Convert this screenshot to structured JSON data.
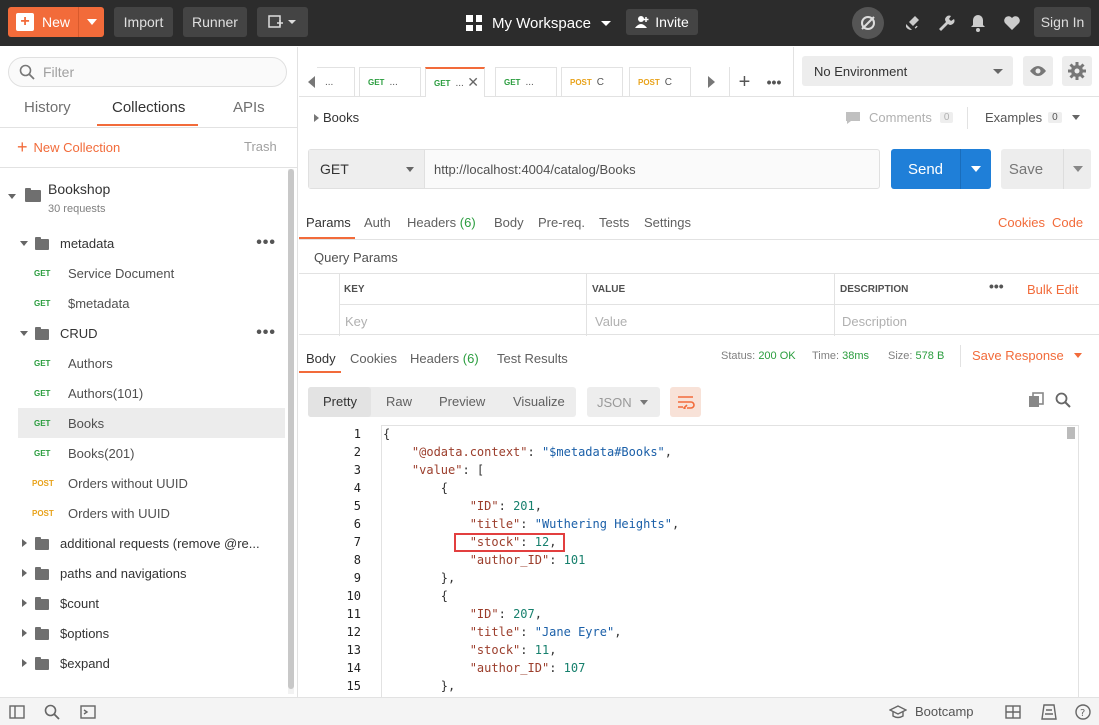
{
  "topbar": {
    "new_label": "New",
    "import_label": "Import",
    "runner_label": "Runner",
    "workspace_label": "My Workspace",
    "invite_label": "Invite",
    "signin_label": "Sign In"
  },
  "sidebar": {
    "filter_placeholder": "Filter",
    "tabs": [
      "History",
      "Collections",
      "APIs"
    ],
    "new_collection_label": "New Collection",
    "trash_label": "Trash",
    "collection": {
      "name": "Bookshop",
      "count": "30 requests"
    },
    "folders": {
      "metadata": "metadata",
      "crud": "CRUD",
      "additional": "additional requests (remove @re...",
      "paths": "paths and navigations",
      "count": "$count",
      "options": "$options",
      "expand": "$expand"
    },
    "requests": [
      {
        "method": "GET",
        "name": "Service Document"
      },
      {
        "method": "GET",
        "name": "$metadata"
      },
      {
        "method": "GET",
        "name": "Authors"
      },
      {
        "method": "GET",
        "name": "Authors(101)"
      },
      {
        "method": "GET",
        "name": "Books"
      },
      {
        "method": "GET",
        "name": "Books(201)"
      },
      {
        "method": "POST",
        "name": "Orders without UUID"
      },
      {
        "method": "POST",
        "name": "Orders with UUID"
      }
    ]
  },
  "request_tabs": [
    {
      "method": "",
      "name": "..."
    },
    {
      "method": "GET",
      "name": "..."
    },
    {
      "method": "GET",
      "name": "..."
    },
    {
      "method": "GET",
      "name": "..."
    },
    {
      "method": "POST",
      "name": "C"
    },
    {
      "method": "POST",
      "name": "C"
    }
  ],
  "environment": {
    "label": "No Environment"
  },
  "breadcrumb": {
    "title": "Books",
    "comments_label": "Comments",
    "comments_count": "0",
    "examples_label": "Examples",
    "examples_count": "0"
  },
  "request": {
    "method": "GET",
    "url": "http://localhost:4004/catalog/Books",
    "send_label": "Send",
    "save_label": "Save"
  },
  "req_tabs": {
    "params": "Params",
    "auth": "Auth",
    "headers": "Headers",
    "headers_count": "(6)",
    "body": "Body",
    "prereq": "Pre-req.",
    "tests": "Tests",
    "settings": "Settings",
    "cookies": "Cookies",
    "code": "Code"
  },
  "params": {
    "title": "Query Params",
    "col_key": "KEY",
    "col_value": "VALUE",
    "col_desc": "DESCRIPTION",
    "bulk_edit": "Bulk Edit",
    "ph_key": "Key",
    "ph_value": "Value",
    "ph_desc": "Description"
  },
  "response": {
    "tabs": {
      "body": "Body",
      "cookies": "Cookies",
      "headers": "Headers",
      "headers_count": "(6)",
      "tests": "Test Results"
    },
    "status_label": "Status:",
    "status_value": "200 OK",
    "time_label": "Time:",
    "time_value": "38ms",
    "size_label": "Size:",
    "size_value": "578 B",
    "save_response": "Save Response",
    "view": {
      "pretty": "Pretty",
      "raw": "Raw",
      "preview": "Preview",
      "visualize": "Visualize",
      "format": "JSON"
    },
    "body": {
      "context_key": "\"@odata.context\"",
      "context_val": "\"$metadata#Books\"",
      "value_key": "\"value\"",
      "id_key": "\"ID\"",
      "title_key": "\"title\"",
      "stock_key": "\"stock\"",
      "author_key": "\"author_ID\"",
      "b1_id": "201",
      "b1_title": "\"Wuthering Heights\"",
      "b1_stock": "12",
      "b1_author": "101",
      "b2_id": "207",
      "b2_title": "\"Jane Eyre\"",
      "b2_stock": "11",
      "b2_author": "107"
    }
  },
  "bottom": {
    "bootcamp_label": "Bootcamp"
  },
  "colors": {
    "accent": "#f26b3a",
    "send": "#1f7fd8",
    "get": "#2a9d3e",
    "post": "#e8a21a",
    "highlight": "#e23f3f"
  }
}
